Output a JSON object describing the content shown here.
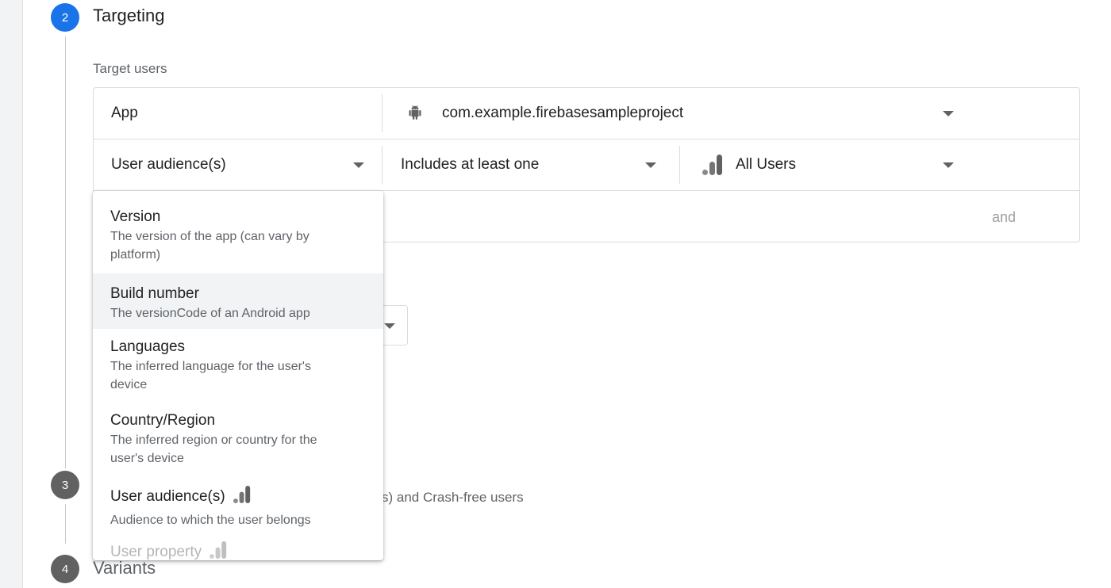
{
  "steps": [
    {
      "number": "2",
      "title": "Targeting",
      "color": "#1a73e8"
    },
    {
      "number": "3",
      "title": "",
      "color": "#616161"
    },
    {
      "number": "4",
      "title": "Variants",
      "color": "#616161"
    }
  ],
  "targeting": {
    "section_label": "Target users",
    "rows": {
      "app_label": "App",
      "app_icon": "android-icon",
      "app_value": "com.example.firebasesampleproject",
      "audience_label": "User audience(s)",
      "condition_value": "Includes at least one",
      "audience_icon": "analytics-icon",
      "audience_value": "All Users",
      "and_label": "and"
    }
  },
  "dropdown": {
    "options": [
      {
        "title": "Version",
        "desc": "The version of the app (can vary by platform)"
      },
      {
        "title": "Build number",
        "desc": "The versionCode of an Android app",
        "active": true
      },
      {
        "title": "Languages",
        "desc": "The inferred language for the user's device"
      },
      {
        "title": "Country/Region",
        "desc": "The inferred region or country for the user's device"
      },
      {
        "title": "User audience(s)",
        "desc": "Audience to which the user belongs",
        "icon": "analytics-icon"
      },
      {
        "title": "User property",
        "desc": "",
        "icon": "analytics-icon"
      }
    ]
  },
  "goals": {
    "partial_text": "s) and Crash-free users"
  }
}
